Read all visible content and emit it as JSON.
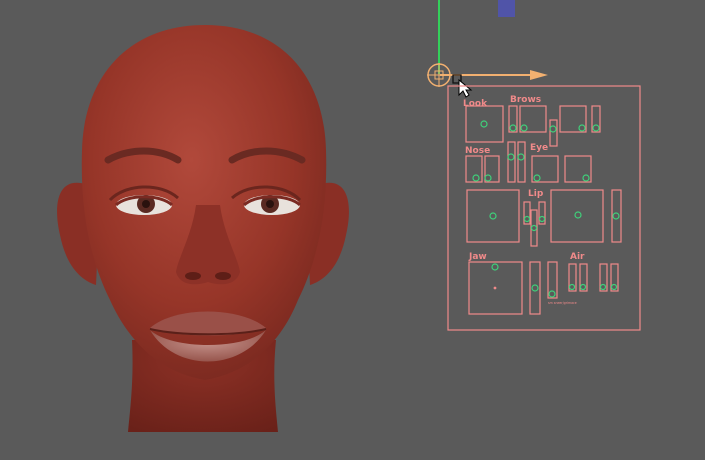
{
  "viewport": {
    "background": "#5a5a5a"
  },
  "colors": {
    "panel_outline": "#f08a8a",
    "handle_ring": "#3fd07a",
    "gizmo_green": "#33d05a",
    "gizmo_orange": "#f2b070",
    "marker_blue": "#5054a8",
    "skin": "#9a3a30"
  },
  "panel": {
    "sections": {
      "look": "Look",
      "brows": "Brows",
      "nose": "Nose",
      "eye": "Eye",
      "lip": "Lip",
      "jaw": "Jaw",
      "air": "Air"
    },
    "tiny_label": "sm\nsneer/grimace"
  },
  "head_model": {
    "icon": "head-model"
  },
  "gizmo": {
    "icon": "move-gizmo"
  },
  "cursor": {
    "icon": "arrow-pointer"
  }
}
